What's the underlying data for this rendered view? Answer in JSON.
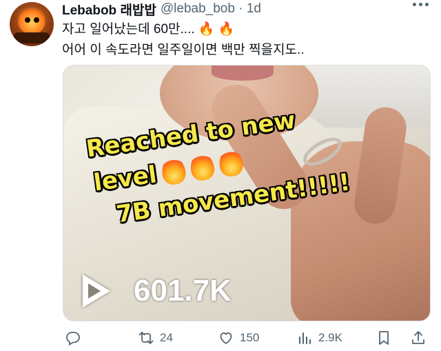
{
  "tweet": {
    "display_name": "Lebabob 래밥밥",
    "handle_time": "@lebab_bob · 1d",
    "text_line1": "자고 일어났는데 60만.... 🔥 🔥",
    "text_line2": "어어 이 속도라면 일주일이면 백만 찍을지도..",
    "more_icon": "more-dots-icon"
  },
  "media": {
    "overlay_line1": "Reached to new",
    "overlay_line2": "level",
    "overlay_line3": "7B movement!!!!!",
    "views": "601.7K"
  },
  "actions": {
    "reply_count": "",
    "retweet_count": "24",
    "like_count": "150",
    "views_count": "2.9K"
  },
  "colors": {
    "text": "#0f1419",
    "secondary": "#536471",
    "overlay_text": "#f5e84a"
  }
}
